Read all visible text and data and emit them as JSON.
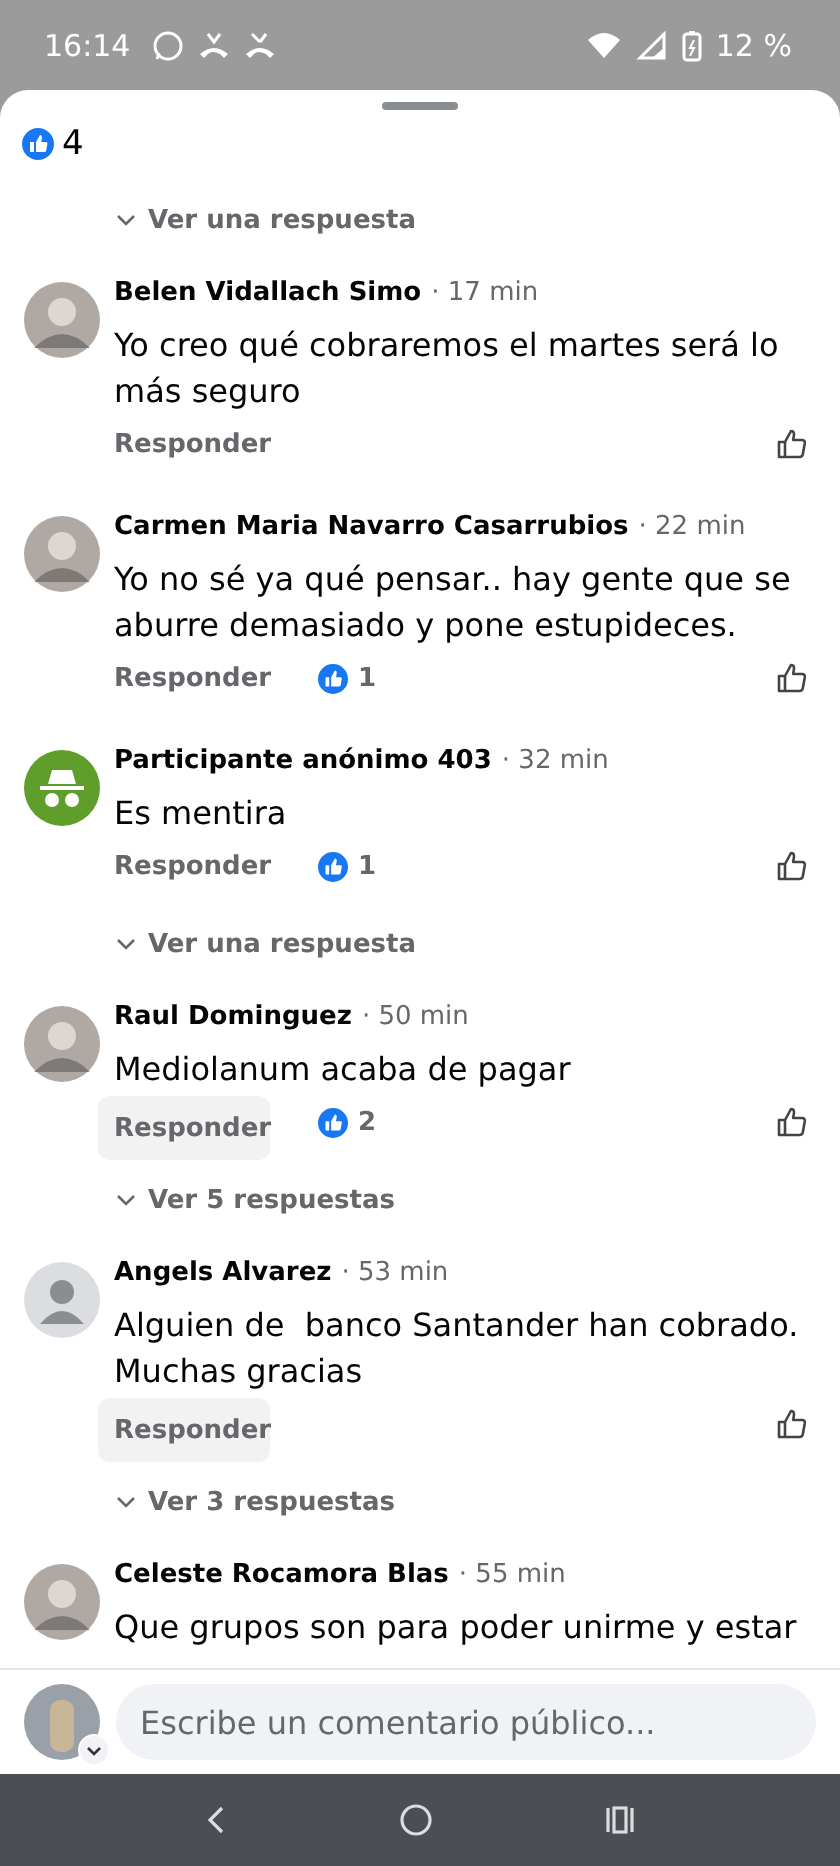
{
  "status_bar": {
    "time": "16:14",
    "battery": "12 %"
  },
  "top_reactions": {
    "count": "4"
  },
  "top_replies_link": "Ver una respuesta",
  "comments": [
    {
      "author": "Belen Vidallach Simo",
      "time": "· 17 min",
      "text": "Yo creo qué cobraremos el martes será lo más seguro",
      "reply_label": "Responder",
      "reply_pressed": false
    },
    {
      "author": "Carmen Maria Navarro Casarrubios",
      "time": "· 22 min",
      "text": "Yo no sé ya qué pensar.. hay gente que se aburre demasiado y pone estupideces.",
      "reply_label": "Responder",
      "reply_pressed": false,
      "reactions": "1"
    },
    {
      "author": "Participante anónimo 403",
      "time": "· 32 min",
      "text": "Es mentira",
      "reply_label": "Responder",
      "reply_pressed": false,
      "reactions": "1",
      "avatar": {
        "kind": "anonymous"
      },
      "replies_link": "Ver una respuesta"
    },
    {
      "author": "Raul Dominguez",
      "time": "· 50 min",
      "text": "Mediolanum acaba de pagar",
      "reply_label": "Responder",
      "reply_pressed": true,
      "reactions": "2",
      "replies_link": "Ver 5 respuestas"
    },
    {
      "author": "Angels Alvarez",
      "time": "· 53 min",
      "text": "Alguien de  banco Santander han cobrado. Muchas gracias",
      "reply_label": "Responder",
      "reply_pressed": true,
      "avatar": {
        "kind": "default"
      },
      "replies_link": "Ver 3 respuestas"
    },
    {
      "author": "Celeste Rocamora Blas",
      "time": "· 55 min",
      "text": "Que grupos son para poder unirme y estar"
    }
  ],
  "composer": {
    "placeholder": "Escribe un comentario público..."
  }
}
